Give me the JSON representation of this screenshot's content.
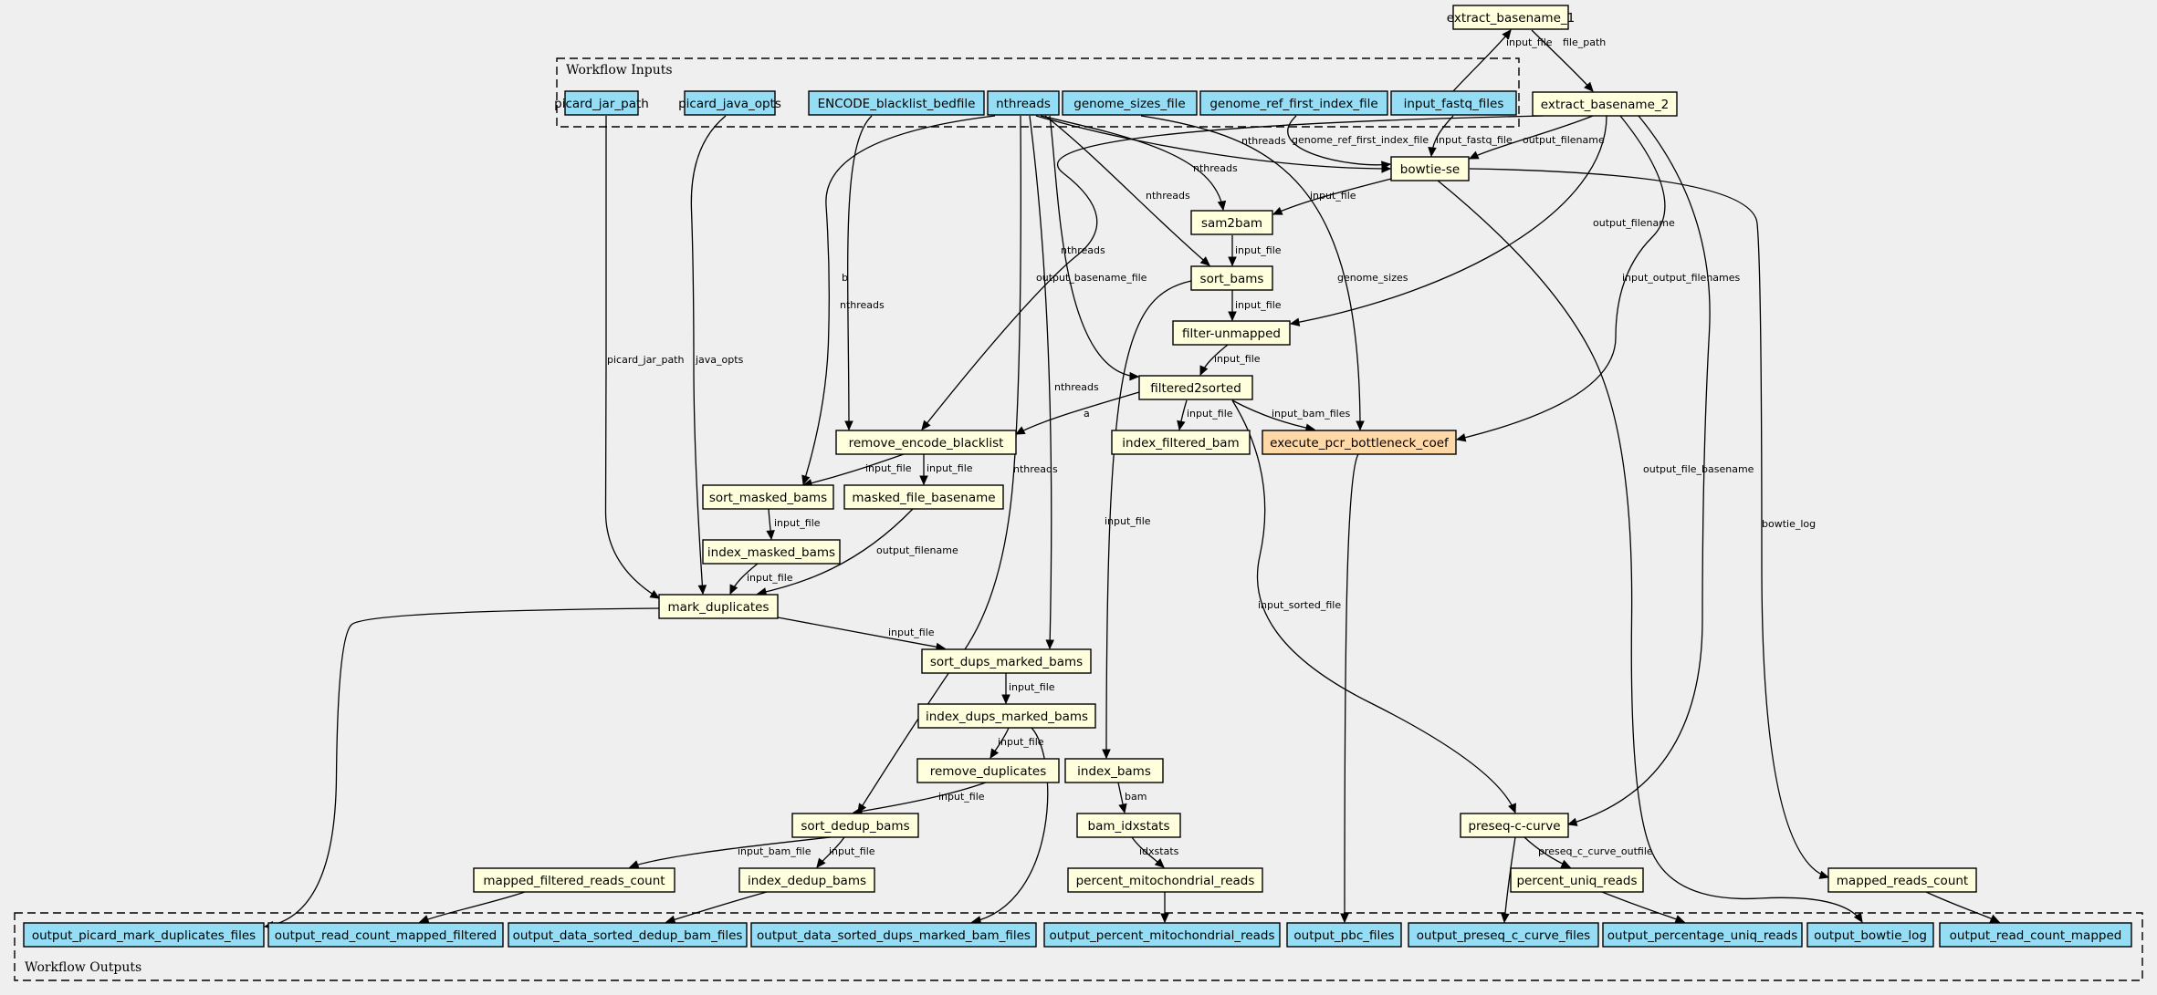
{
  "colors": {
    "background": "#efefef",
    "input_node": "#94ddf4",
    "step_node": "#ffffdd",
    "highlight_node": "#ffd8a8",
    "output_node": "#94ddf4"
  },
  "clusters": {
    "inputs_title": "Workflow Inputs",
    "outputs_title": "Workflow Outputs"
  },
  "nodes": [
    {
      "id": "picard_jar_path",
      "label": "picard_jar_path",
      "kind": "input"
    },
    {
      "id": "picard_java_opts",
      "label": "picard_java_opts",
      "kind": "input"
    },
    {
      "id": "ENCODE_blacklist_bedfile",
      "label": "ENCODE_blacklist_bedfile",
      "kind": "input"
    },
    {
      "id": "nthreads",
      "label": "nthreads",
      "kind": "input"
    },
    {
      "id": "genome_sizes_file",
      "label": "genome_sizes_file",
      "kind": "input"
    },
    {
      "id": "genome_ref_first_index_file",
      "label": "genome_ref_first_index_file",
      "kind": "input"
    },
    {
      "id": "input_fastq_files",
      "label": "input_fastq_files",
      "kind": "input"
    },
    {
      "id": "extract_basename_1",
      "label": "extract_basename_1",
      "kind": "step"
    },
    {
      "id": "extract_basename_2",
      "label": "extract_basename_2",
      "kind": "step"
    },
    {
      "id": "bowtie_se",
      "label": "bowtie-se",
      "kind": "step"
    },
    {
      "id": "sam2bam",
      "label": "sam2bam",
      "kind": "step"
    },
    {
      "id": "sort_bams",
      "label": "sort_bams",
      "kind": "step"
    },
    {
      "id": "filter_unmapped",
      "label": "filter-unmapped",
      "kind": "step"
    },
    {
      "id": "filtered2sorted",
      "label": "filtered2sorted",
      "kind": "step"
    },
    {
      "id": "remove_encode_blacklist",
      "label": "remove_encode_blacklist",
      "kind": "step"
    },
    {
      "id": "index_filtered_bam",
      "label": "index_filtered_bam",
      "kind": "step"
    },
    {
      "id": "execute_pcr_bottleneck_coef",
      "label": "execute_pcr_bottleneck_coef",
      "kind": "highlight"
    },
    {
      "id": "sort_masked_bams",
      "label": "sort_masked_bams",
      "kind": "step"
    },
    {
      "id": "masked_file_basename",
      "label": "masked_file_basename",
      "kind": "step"
    },
    {
      "id": "index_masked_bams",
      "label": "index_masked_bams",
      "kind": "step"
    },
    {
      "id": "mark_duplicates",
      "label": "mark_duplicates",
      "kind": "step"
    },
    {
      "id": "sort_dups_marked_bams",
      "label": "sort_dups_marked_bams",
      "kind": "step"
    },
    {
      "id": "index_dups_marked_bams",
      "label": "index_dups_marked_bams",
      "kind": "step"
    },
    {
      "id": "remove_duplicates",
      "label": "remove_duplicates",
      "kind": "step"
    },
    {
      "id": "index_bams",
      "label": "index_bams",
      "kind": "step"
    },
    {
      "id": "sort_dedup_bams",
      "label": "sort_dedup_bams",
      "kind": "step"
    },
    {
      "id": "bam_idxstats",
      "label": "bam_idxstats",
      "kind": "step"
    },
    {
      "id": "preseq_c_curve",
      "label": "preseq-c-curve",
      "kind": "step"
    },
    {
      "id": "mapped_filtered_reads_count",
      "label": "mapped_filtered_reads_count",
      "kind": "step"
    },
    {
      "id": "index_dedup_bams",
      "label": "index_dedup_bams",
      "kind": "step"
    },
    {
      "id": "percent_mitochondrial_reads",
      "label": "percent_mitochondrial_reads",
      "kind": "step"
    },
    {
      "id": "percent_uniq_reads",
      "label": "percent_uniq_reads",
      "kind": "step"
    },
    {
      "id": "mapped_reads_count",
      "label": "mapped_reads_count",
      "kind": "step"
    },
    {
      "id": "output_picard_mark_duplicates_files",
      "label": "output_picard_mark_duplicates_files",
      "kind": "output"
    },
    {
      "id": "output_read_count_mapped_filtered",
      "label": "output_read_count_mapped_filtered",
      "kind": "output"
    },
    {
      "id": "output_data_sorted_dedup_bam_files",
      "label": "output_data_sorted_dedup_bam_files",
      "kind": "output"
    },
    {
      "id": "output_data_sorted_dups_marked_bam_files",
      "label": "output_data_sorted_dups_marked_bam_files",
      "kind": "output"
    },
    {
      "id": "output_percent_mitochondrial_reads",
      "label": "output_percent_mitochondrial_reads",
      "kind": "output"
    },
    {
      "id": "output_pbc_files",
      "label": "output_pbc_files",
      "kind": "output"
    },
    {
      "id": "output_preseq_c_curve_files",
      "label": "output_preseq_c_curve_files",
      "kind": "output"
    },
    {
      "id": "output_percentage_uniq_reads",
      "label": "output_percentage_uniq_reads",
      "kind": "output"
    },
    {
      "id": "output_bowtie_log",
      "label": "output_bowtie_log",
      "kind": "output"
    },
    {
      "id": "output_read_count_mapped",
      "label": "output_read_count_mapped",
      "kind": "output"
    }
  ],
  "edges": [
    {
      "from": "input_fastq_files",
      "to": "extract_basename_1",
      "label": "input_file"
    },
    {
      "from": "extract_basename_1",
      "to": "extract_basename_2",
      "label": "file_path"
    },
    {
      "from": "nthreads",
      "to": "bowtie_se",
      "label": "nthreads"
    },
    {
      "from": "genome_ref_first_index_file",
      "to": "bowtie_se",
      "label": "genome_ref_first_index_file"
    },
    {
      "from": "input_fastq_files",
      "to": "bowtie_se",
      "label": "input_fastq_file"
    },
    {
      "from": "extract_basename_2",
      "to": "bowtie_se",
      "label": "output_filename"
    },
    {
      "from": "bowtie_se",
      "to": "sam2bam",
      "label": "input_file"
    },
    {
      "from": "nthreads",
      "to": "sam2bam",
      "label": "nthreads"
    },
    {
      "from": "sam2bam",
      "to": "sort_bams",
      "label": "input_file"
    },
    {
      "from": "nthreads",
      "to": "sort_bams",
      "label": "nthreads"
    },
    {
      "from": "sort_bams",
      "to": "filter_unmapped",
      "label": "input_file"
    },
    {
      "from": "extract_basename_2",
      "to": "filter_unmapped",
      "label": "output_filename"
    },
    {
      "from": "filter_unmapped",
      "to": "filtered2sorted",
      "label": "input_file"
    },
    {
      "from": "nthreads",
      "to": "filtered2sorted",
      "label": "nthreads"
    },
    {
      "from": "genome_sizes_file",
      "to": "execute_pcr_bottleneck_coef",
      "label": "genome_sizes"
    },
    {
      "from": "extract_basename_2",
      "to": "execute_pcr_bottleneck_coef",
      "label": "input_output_filenames"
    },
    {
      "from": "filtered2sorted",
      "to": "execute_pcr_bottleneck_coef",
      "label": "input_bam_files"
    },
    {
      "from": "filtered2sorted",
      "to": "index_filtered_bam",
      "label": "input_file"
    },
    {
      "from": "filtered2sorted",
      "to": "remove_encode_blacklist",
      "label": "a"
    },
    {
      "from": "ENCODE_blacklist_bedfile",
      "to": "remove_encode_blacklist",
      "label": "b"
    },
    {
      "from": "extract_basename_2",
      "to": "remove_encode_blacklist",
      "label": "output_basename_file"
    },
    {
      "from": "remove_encode_blacklist",
      "to": "sort_masked_bams",
      "label": "input_file"
    },
    {
      "from": "nthreads",
      "to": "sort_masked_bams",
      "label": "nthreads"
    },
    {
      "from": "remove_encode_blacklist",
      "to": "masked_file_basename",
      "label": "input_file"
    },
    {
      "from": "sort_masked_bams",
      "to": "index_masked_bams",
      "label": "input_file"
    },
    {
      "from": "index_masked_bams",
      "to": "mark_duplicates",
      "label": "input_file"
    },
    {
      "from": "picard_jar_path",
      "to": "mark_duplicates",
      "label": "picard_jar_path"
    },
    {
      "from": "picard_java_opts",
      "to": "mark_duplicates",
      "label": "java_opts"
    },
    {
      "from": "masked_file_basename",
      "to": "mark_duplicates",
      "label": "output_filename"
    },
    {
      "from": "mark_duplicates",
      "to": "sort_dups_marked_bams",
      "label": "input_file"
    },
    {
      "from": "nthreads",
      "to": "sort_dups_marked_bams",
      "label": "nthreads"
    },
    {
      "from": "sort_dups_marked_bams",
      "to": "index_dups_marked_bams",
      "label": "input_file"
    },
    {
      "from": "index_dups_marked_bams",
      "to": "remove_duplicates",
      "label": "input_file"
    },
    {
      "from": "remove_duplicates",
      "to": "sort_dedup_bams",
      "label": "input_file"
    },
    {
      "from": "nthreads",
      "to": "sort_dedup_bams",
      "label": "nthreads"
    },
    {
      "from": "sort_bams",
      "to": "index_bams",
      "label": "input_file"
    },
    {
      "from": "index_bams",
      "to": "bam_idxstats",
      "label": "bam"
    },
    {
      "from": "bam_idxstats",
      "to": "percent_mitochondrial_reads",
      "label": "idxstats"
    },
    {
      "from": "filtered2sorted",
      "to": "preseq_c_curve",
      "label": "input_sorted_file"
    },
    {
      "from": "extract_basename_2",
      "to": "preseq_c_curve",
      "label": "output_file_basename"
    },
    {
      "from": "preseq_c_curve",
      "to": "percent_uniq_reads",
      "label": "preseq_c_curve_outfile"
    },
    {
      "from": "sort_dedup_bams",
      "to": "mapped_filtered_reads_count",
      "label": "input_bam_file"
    },
    {
      "from": "sort_dedup_bams",
      "to": "index_dedup_bams",
      "label": "input_file"
    },
    {
      "from": "bowtie_se",
      "to": "mapped_reads_count",
      "label": "bowtie_log"
    },
    {
      "from": "mark_duplicates",
      "to": "output_picard_mark_duplicates_files",
      "label": ""
    },
    {
      "from": "mapped_filtered_reads_count",
      "to": "output_read_count_mapped_filtered",
      "label": ""
    },
    {
      "from": "index_dedup_bams",
      "to": "output_data_sorted_dedup_bam_files",
      "label": ""
    },
    {
      "from": "index_dups_marked_bams",
      "to": "output_data_sorted_dups_marked_bam_files",
      "label": ""
    },
    {
      "from": "percent_mitochondrial_reads",
      "to": "output_percent_mitochondrial_reads",
      "label": ""
    },
    {
      "from": "execute_pcr_bottleneck_coef",
      "to": "output_pbc_files",
      "label": ""
    },
    {
      "from": "preseq_c_curve",
      "to": "output_preseq_c_curve_files",
      "label": ""
    },
    {
      "from": "percent_uniq_reads",
      "to": "output_percentage_uniq_reads",
      "label": ""
    },
    {
      "from": "bowtie_se",
      "to": "output_bowtie_log",
      "label": ""
    },
    {
      "from": "mapped_reads_count",
      "to": "output_read_count_mapped",
      "label": ""
    }
  ]
}
